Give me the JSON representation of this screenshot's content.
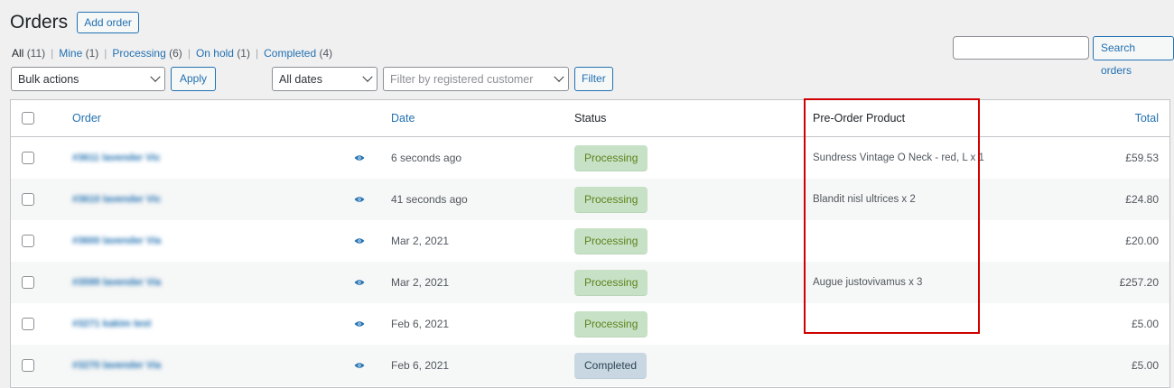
{
  "header": {
    "title": "Orders",
    "add_order_label": "Add order"
  },
  "views": [
    {
      "label": "All",
      "count": "(11)",
      "current": true
    },
    {
      "label": "Mine",
      "count": "(1)",
      "current": false
    },
    {
      "label": "Processing",
      "count": "(6)",
      "current": false
    },
    {
      "label": "On hold",
      "count": "(1)",
      "current": false
    },
    {
      "label": "Completed",
      "count": "(4)",
      "current": false
    }
  ],
  "search": {
    "value": "",
    "button_label": "Search orders"
  },
  "filters": {
    "bulk_actions": "Bulk actions",
    "apply_label": "Apply",
    "dates": "All dates",
    "customer_placeholder": "Filter by registered customer",
    "filter_label": "Filter"
  },
  "table": {
    "columns": {
      "order": "Order",
      "date": "Date",
      "status": "Status",
      "preorder": "Pre-Order Product",
      "total": "Total"
    },
    "rows": [
      {
        "order": "#3611 lavender Vic",
        "date": "6 seconds ago",
        "status": "Processing",
        "preorder": "Sundress Vintage O Neck - red, L x 1",
        "total": "£59.53"
      },
      {
        "order": "#3610 lavender Vic",
        "date": "41 seconds ago",
        "status": "Processing",
        "preorder": "Blandit nisl ultrices x 2",
        "total": "£24.80"
      },
      {
        "order": "#3600 lavender Via",
        "date": "Mar 2, 2021",
        "status": "Processing",
        "preorder": "",
        "total": "£20.00"
      },
      {
        "order": "#3599 lavender Via",
        "date": "Mar 2, 2021",
        "status": "Processing",
        "preorder": "Augue justovivamus x 3",
        "total": "£257.20"
      },
      {
        "order": "#3271 kakim test",
        "date": "Feb 6, 2021",
        "status": "Processing",
        "preorder": "",
        "total": "£5.00"
      },
      {
        "order": "#3270 lavender Via",
        "date": "Feb 6, 2021",
        "status": "Completed",
        "preorder": "",
        "total": "£5.00"
      }
    ]
  },
  "colors": {
    "accent": "#2271b1",
    "processing_bg": "#c6e1c6",
    "processing_text": "#5b841b",
    "completed_bg": "#c8d7e1",
    "completed_text": "#2e4453",
    "highlight": "#d00000"
  },
  "icons": {
    "preview": "eye-icon",
    "dropdown": "chevron-down-icon"
  }
}
